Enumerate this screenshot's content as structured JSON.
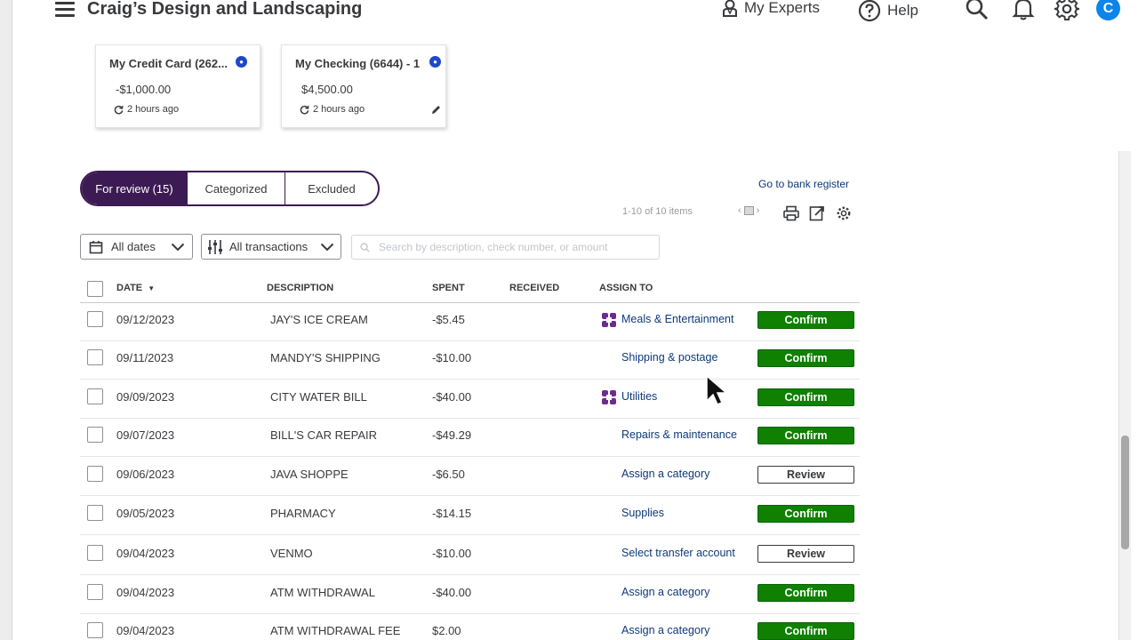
{
  "header": {
    "company_name": "Craig’s Design and Landscaping",
    "my_experts_label": "My Experts",
    "help_label": "Help",
    "avatar_initial": "C",
    "icons": [
      "menu-icon",
      "experts-icon",
      "help-icon",
      "search-icon",
      "bell-icon",
      "gear-icon"
    ]
  },
  "accounts": [
    {
      "name": "My Credit Card (262...",
      "balance": "-$1,000.00",
      "updated": "2 hours ago"
    },
    {
      "name": "My Checking (6644) - 1",
      "balance": "$4,500.00",
      "updated": "2 hours ago"
    }
  ],
  "tabs": [
    {
      "label": "For review (15)",
      "active": true
    },
    {
      "label": "Categorized",
      "active": false
    },
    {
      "label": "Excluded",
      "active": false
    }
  ],
  "toolbar": {
    "bank_register_link": "Go to bank register",
    "pagination": "1-10 of 10 items",
    "icons": [
      "print-icon",
      "export-icon",
      "settings-icon"
    ]
  },
  "filters": {
    "dates_label": "All dates",
    "transactions_label": "All transactions",
    "search_placeholder": "Search by description, check number, or amount",
    "search_value": ""
  },
  "table": {
    "columns": [
      "DATE",
      "DESCRIPTION",
      "SPENT",
      "RECEIVED",
      "ASSIGN TO"
    ],
    "sort_column": "DATE",
    "rows": [
      {
        "date": "09/12/2023",
        "description": "JAY'S ICE CREAM",
        "spent": "-$5.45",
        "received": "",
        "assign_to": "Meals & Entertainment",
        "rule_icon": true,
        "action": "Confirm"
      },
      {
        "date": "09/11/2023",
        "description": "MANDY'S SHIPPING",
        "spent": "-$10.00",
        "received": "",
        "assign_to": "Shipping & postage",
        "rule_icon": false,
        "action": "Confirm"
      },
      {
        "date": "09/09/2023",
        "description": "CITY WATER BILL",
        "spent": "-$40.00",
        "received": "",
        "assign_to": "Utilities",
        "rule_icon": true,
        "action": "Confirm"
      },
      {
        "date": "09/07/2023",
        "description": "BILL'S CAR REPAIR",
        "spent": "-$49.29",
        "received": "",
        "assign_to": "Repairs & maintenance",
        "rule_icon": false,
        "action": "Confirm"
      },
      {
        "date": "09/06/2023",
        "description": "JAVA SHOPPE",
        "spent": "-$6.50",
        "received": "",
        "assign_to": "Assign a category",
        "rule_icon": false,
        "action": "Review"
      },
      {
        "date": "09/05/2023",
        "description": "PHARMACY",
        "spent": "-$14.15",
        "received": "",
        "assign_to": "Supplies",
        "rule_icon": false,
        "action": "Confirm"
      },
      {
        "date": "09/04/2023",
        "description": "VENMO",
        "spent": "-$10.00",
        "received": "",
        "assign_to": "Select transfer account",
        "rule_icon": false,
        "action": "Review"
      },
      {
        "date": "09/04/2023",
        "description": "ATM WITHDRAWAL",
        "spent": "-$40.00",
        "received": "",
        "assign_to": "Assign a category",
        "rule_icon": false,
        "action": "Confirm"
      },
      {
        "date": "09/04/2023",
        "description": "ATM WITHDRAWAL FEE",
        "spent": "$2.00",
        "received": "",
        "assign_to": "Assign a category",
        "rule_icon": false,
        "action": "Confirm"
      }
    ]
  },
  "colors": {
    "brand_purple": "#3c1a53",
    "confirm_green": "#108000",
    "link_blue": "#0d3a7a",
    "avatar_blue": "#0d84e8",
    "rule_icon_purple": "#6b2c8f"
  }
}
